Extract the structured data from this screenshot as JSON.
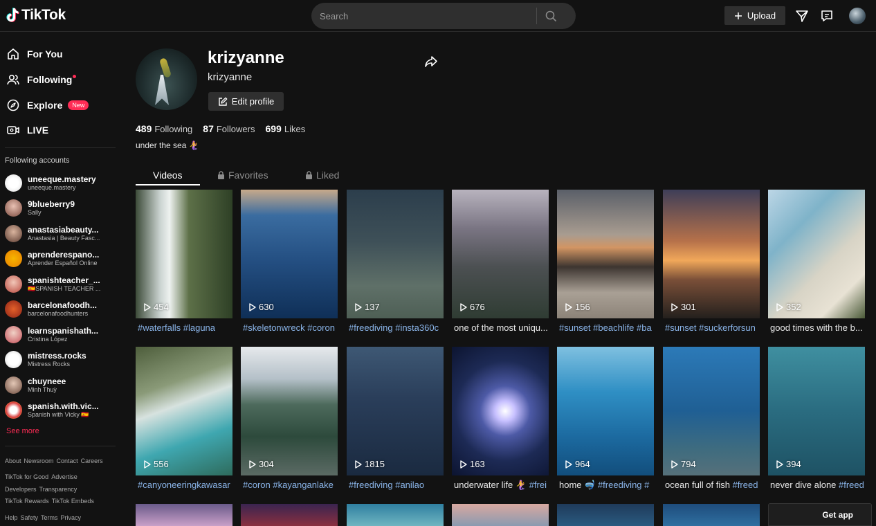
{
  "header": {
    "logo_text": "TikTok",
    "search_placeholder": "Search",
    "upload_label": "Upload"
  },
  "sidebar": {
    "nav": [
      {
        "label": "For You",
        "icon": "home-icon"
      },
      {
        "label": "Following",
        "icon": "people-icon"
      },
      {
        "label": "Explore",
        "icon": "compass-icon",
        "badge": "New"
      },
      {
        "label": "LIVE",
        "icon": "live-icon"
      }
    ],
    "following_title": "Following accounts",
    "accounts": [
      {
        "username": "uneeque.mastery",
        "display": "uneeque.mastery"
      },
      {
        "username": "9blueberry9",
        "display": "Sally"
      },
      {
        "username": "anastasiabeauty...",
        "display": "Anastasia | Beauty Fasc..."
      },
      {
        "username": "aprenderespano...",
        "display": "Aprender Español Online"
      },
      {
        "username": "spanishteacher_...",
        "display": "🇪🇸SPANISH TEACHER ..."
      },
      {
        "username": "barcelonafoodh...",
        "display": "barcelonafoodhunters"
      },
      {
        "username": "learnspanishath...",
        "display": "Cristina López"
      },
      {
        "username": "mistress.rocks",
        "display": "Mistress Rocks"
      },
      {
        "username": "chuyneee",
        "display": "Minh Thuỳ"
      },
      {
        "username": "spanish.with.vic...",
        "display": "Spanish with Vicky 🇪🇸"
      }
    ],
    "see_more": "See more",
    "footer": [
      [
        "About",
        "Newsroom",
        "Contact",
        "Careers"
      ],
      [
        "TikTok for Good",
        "Advertise"
      ],
      [
        "Developers",
        "Transparency"
      ],
      [
        "TikTok Rewards",
        "TikTok Embeds"
      ],
      [
        "Help",
        "Safety",
        "Terms",
        "Privacy"
      ]
    ]
  },
  "profile": {
    "username": "krizyanne",
    "nickname": "krizyanne",
    "edit_label": "Edit profile",
    "following_count": "489",
    "following_label": "Following",
    "followers_count": "87",
    "followers_label": "Followers",
    "likes_count": "699",
    "likes_label": "Likes",
    "bio": "under the sea 🧜‍♀️"
  },
  "tabs": [
    {
      "label": "Videos",
      "active": true
    },
    {
      "label": "Favorites",
      "locked": true
    },
    {
      "label": "Liked",
      "locked": true
    }
  ],
  "videos": [
    {
      "views": "454",
      "caption_tags": "#waterfalls #laguna",
      "caption_text": ""
    },
    {
      "views": "630",
      "caption_tags": "#skeletonwreck #coron",
      "caption_text": ""
    },
    {
      "views": "137",
      "caption_tags": "#freediving #insta360c",
      "caption_text": ""
    },
    {
      "views": "676",
      "caption_tags": "",
      "caption_text": "one of the most uniqu..."
    },
    {
      "views": "156",
      "caption_tags": "#sunset #beachlife #ba",
      "caption_text": ""
    },
    {
      "views": "301",
      "caption_tags": "#sunset #suckerforsun",
      "caption_text": ""
    },
    {
      "views": "352",
      "caption_tags": "",
      "caption_text": "good times with the b..."
    },
    {
      "views": "556",
      "caption_tags": "#canyoneeringkawasar",
      "caption_text": ""
    },
    {
      "views": "304",
      "caption_tags": "#coron #kayanganlake",
      "caption_text": ""
    },
    {
      "views": "1815",
      "caption_tags": "#freediving #anilao",
      "caption_text": ""
    },
    {
      "views": "163",
      "caption_tags": "#frei",
      "caption_text": "underwater life 🧜‍♀️ "
    },
    {
      "views": "964",
      "caption_tags": "#freediving #",
      "caption_text": "home 🤿 "
    },
    {
      "views": "794",
      "caption_tags": "#freed",
      "caption_text": "ocean full of fish "
    },
    {
      "views": "394",
      "caption_tags": "#freed",
      "caption_text": "never dive alone "
    }
  ],
  "get_app": "Get app",
  "colors": {
    "accent": "#fe2c55",
    "tag": "#8ab4e8",
    "bg": "#121212"
  }
}
